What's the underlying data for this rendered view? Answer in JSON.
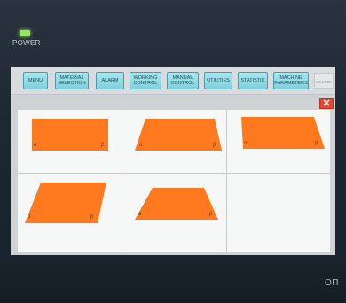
{
  "device": {
    "power_label": "POWER",
    "brand_mark": "OП"
  },
  "nav": {
    "items": [
      {
        "label": "MENU"
      },
      {
        "label": "MATERIAL SELECTION"
      },
      {
        "label": "ALARM"
      },
      {
        "label": "WORKING CONTROL"
      },
      {
        "label": "MANUAL CONTROL"
      },
      {
        "label": "UTILITIES"
      },
      {
        "label": "STATISTIC"
      },
      {
        "label": "MACHINE PARAMETERS"
      }
    ],
    "time": "04:17:00"
  },
  "close_label": "✕",
  "shapes": [
    {
      "left_corner": "α",
      "right_corner": "β"
    },
    {
      "left_corner": "α",
      "right_corner": "β"
    },
    {
      "left_corner": "α",
      "right_corner": "β"
    },
    {
      "left_corner": "α",
      "right_corner": "β"
    },
    {
      "left_corner": "α",
      "right_corner": "β"
    }
  ],
  "colors": {
    "shape_fill": "#ff7a1e",
    "nav_button": "#8ed8e2",
    "close_button": "#e8462e"
  }
}
